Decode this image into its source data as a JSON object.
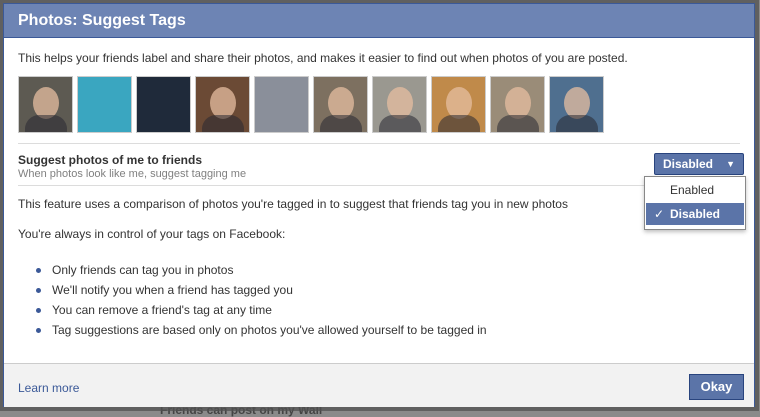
{
  "dialog": {
    "title": "Photos: Suggest Tags",
    "intro": "This helps your friends label and share their photos, and makes it easier to find out when photos of you are posted."
  },
  "photos": [
    {
      "bg": "#5d5a52",
      "face": true
    },
    {
      "bg": "#3aa6c0",
      "face": false
    },
    {
      "bg": "#1f2a3a",
      "face": false
    },
    {
      "bg": "#6b4a35",
      "face": true
    },
    {
      "bg": "#8a8f9a",
      "face": false
    },
    {
      "bg": "#7d7060",
      "face": true
    },
    {
      "bg": "#9a9890",
      "face": true
    },
    {
      "bg": "#c08a4a",
      "face": true
    },
    {
      "bg": "#9a8c78",
      "face": true
    },
    {
      "bg": "#4f6f8f",
      "face": true
    }
  ],
  "setting": {
    "title": "Suggest photos of me to friends",
    "subtitle": "When photos look like me, suggest tagging me",
    "selected": "Disabled",
    "options": [
      "Enabled",
      "Disabled"
    ],
    "checkmark": "✓"
  },
  "body": {
    "description": "This feature uses a comparison of photos you're tagged in to suggest that friends tag you in new photos",
    "control": "You're always in control of your tags on Facebook:",
    "bullets": [
      "Only friends can tag you in photos",
      "We'll notify you when a friend has tagged you",
      "You can remove a friend's tag at any time",
      "Tag suggestions are based only on photos you've allowed yourself to be tagged in"
    ]
  },
  "footer": {
    "learn_more": "Learn more",
    "okay": "Okay"
  },
  "backdrop": {
    "text": "Friends can post on my Wall"
  },
  "colors": {
    "title_bar": "#6d84b4",
    "accent": "#3b5998",
    "button": "#5b74a8"
  }
}
